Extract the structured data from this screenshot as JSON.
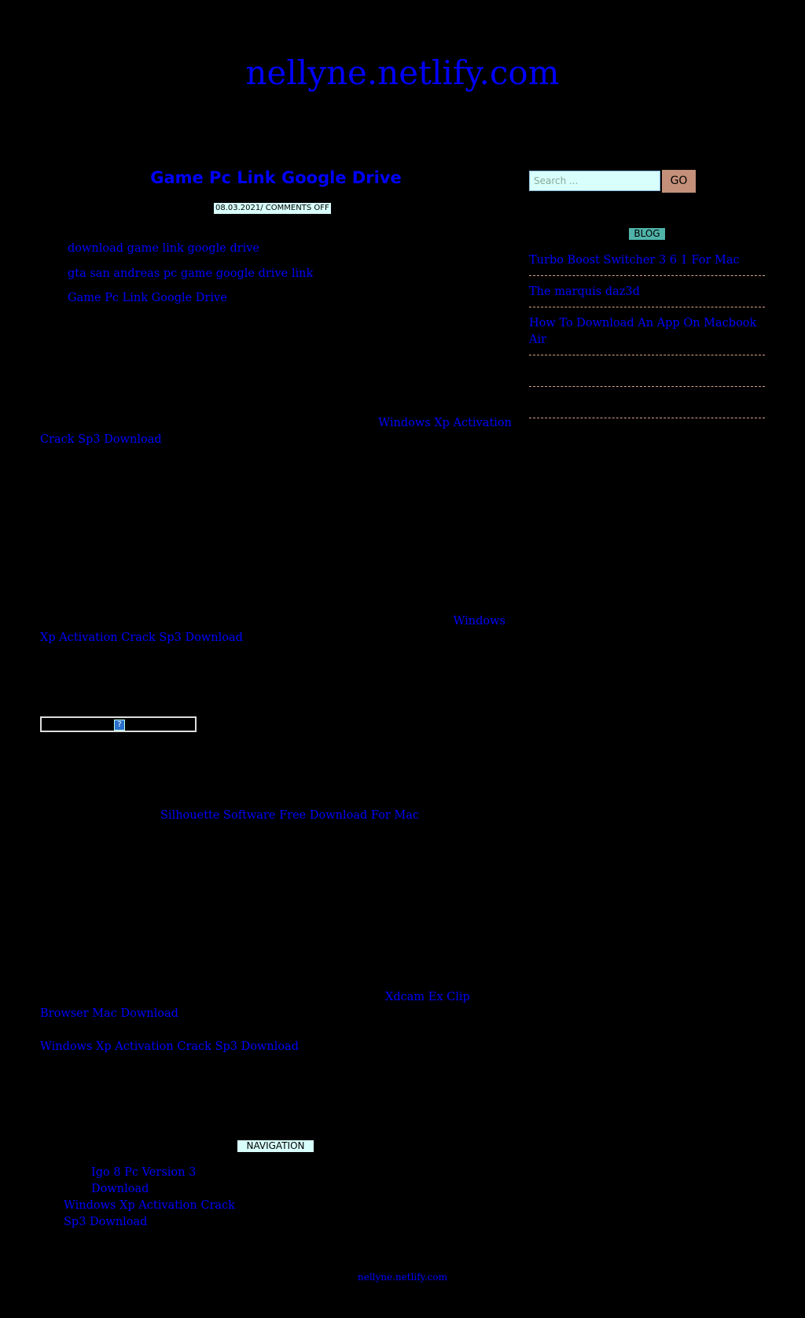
{
  "site": {
    "title": "nellyne.netlify.com",
    "footer": "nellyne.netlify.com"
  },
  "post": {
    "title": "Game Pc Link Google Drive",
    "meta": "08.03.2021/ COMMENTS OFF",
    "tags": [
      "download game link google drive",
      "gta san andreas pc game google drive link",
      "Game Pc Link Google Drive"
    ],
    "para1": {
      "line1": "Windows Xp Activation",
      "line2": "Crack Sp3 Download"
    },
    "para2": {
      "line1": "Windows",
      "line2": "Xp Activation Crack Sp3 Download"
    },
    "image_icon": "?",
    "para3": "Silhouette Software Free Download For Mac",
    "para4": {
      "line1": "Xdcam Ex Clip",
      "line2": "Browser Mac Download"
    },
    "para5": "Windows Xp Activation Crack Sp3 Download"
  },
  "navigation": {
    "label": "NAVIGATION",
    "items": [
      "Igo 8 Pc Version 3 Download",
      "Windows Xp Activation Crack",
      "Sp3 Download"
    ]
  },
  "sidebar": {
    "search_placeholder": "Search ...",
    "go_label": "GO",
    "blog_label": "BLOG",
    "items": [
      "Turbo Boost Switcher 3 6 1 For Mac",
      "The marquis daz3d",
      "How To Download An App On Macbook Air",
      "",
      ""
    ]
  }
}
